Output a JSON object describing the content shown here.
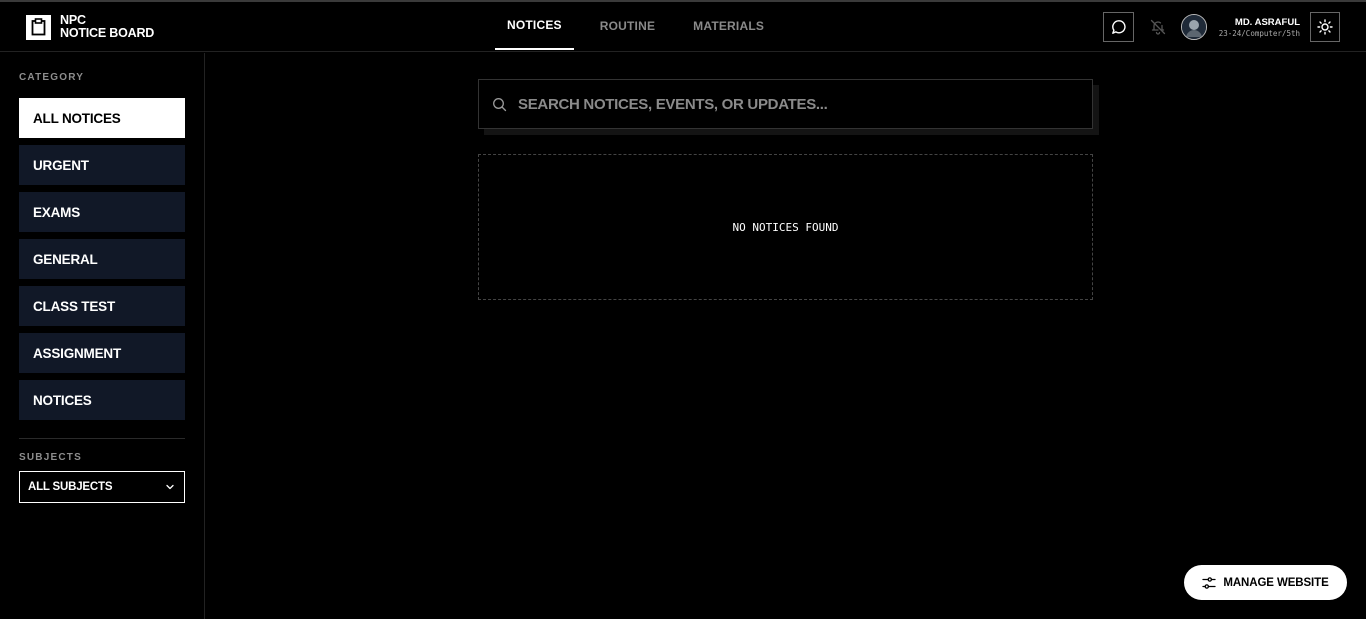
{
  "header": {
    "logo_line1": "NPC",
    "logo_line2": "NOTICE BOARD",
    "nav": [
      {
        "label": "NOTICES",
        "active": true
      },
      {
        "label": "ROUTINE",
        "active": false
      },
      {
        "label": "MATERIALS",
        "active": false
      }
    ],
    "user_name": "MD. ASRAFUL",
    "user_info": "23-24/Computer/5th",
    "icons": {
      "chat": "chat-bubble-icon",
      "bell": "bell-off-icon",
      "theme": "sun-icon"
    }
  },
  "sidebar": {
    "category_label": "CATEGORY",
    "categories": [
      {
        "label": "ALL NOTICES",
        "active": true
      },
      {
        "label": "URGENT",
        "active": false
      },
      {
        "label": "EXAMS",
        "active": false
      },
      {
        "label": "GENERAL",
        "active": false
      },
      {
        "label": "CLASS TEST",
        "active": false
      },
      {
        "label": "ASSIGNMENT",
        "active": false
      },
      {
        "label": "NOTICES",
        "active": false
      }
    ],
    "subjects_label": "SUBJECTS",
    "subject_selected": "ALL SUBJECTS"
  },
  "main": {
    "search_placeholder": "SEARCH NOTICES, EVENTS, OR UPDATES...",
    "search_value": "",
    "empty_message": "NO NOTICES FOUND"
  },
  "manage_button": "MANAGE WEBSITE",
  "colors": {
    "background": "#000000",
    "sidebar_item": "#111827",
    "active_item": "#ffffff",
    "muted_text": "#8a8a8a"
  }
}
